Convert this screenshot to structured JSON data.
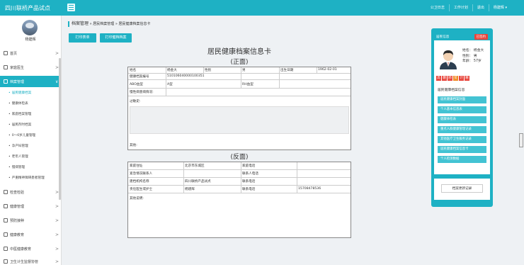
{
  "app": {
    "title": "四川联桥产品试点"
  },
  "topnav": {
    "links": [
      "公卫日志",
      "工作计划",
      "退出",
      "杨建辉 ▾"
    ]
  },
  "sidebar": {
    "user_name": "杨建辉",
    "items": [
      {
        "label": "首页",
        "chevron": ">"
      },
      {
        "label": "家庭医生",
        "chevron": ">"
      },
      {
        "label": "档案管理",
        "chevron": "∨"
      }
    ],
    "sub_items": [
      "居民健康档案",
      "健康体检表",
      "家庭档案管理",
      "居民剂时档案",
      "0～6岁儿童管理",
      "孕产妇管理",
      "老年人管理",
      "慢病管理",
      "严重精神障碍患者管理"
    ],
    "items_after": [
      {
        "label": "检查检验",
        "chevron": ">"
      },
      {
        "label": "健康管理",
        "chevron": ">"
      },
      {
        "label": "预防接种",
        "chevron": ">"
      },
      {
        "label": "健康教育",
        "chevron": ">"
      },
      {
        "label": "中医健康教育",
        "chevron": ">"
      },
      {
        "label": "卫生计生监督协管",
        "chevron": ">"
      }
    ]
  },
  "breadcrumb": {
    "root": "档案管理",
    "sep": "»",
    "p1": "居民档案管理",
    "p2": "居民健康档案信息卡"
  },
  "actions": {
    "print_list": "打印表单",
    "print_card": "打印健档档案"
  },
  "card": {
    "title": "居民健康档案信息卡",
    "front_label": "(正面)",
    "back_label": "(反面)",
    "front": {
      "name_label": "姓名",
      "name": "杨金大",
      "gender_label": "性别",
      "gender": "男",
      "dob_label": "出生日期",
      "dob": "1962-02-01",
      "record_no_label": "健康档案编号",
      "record_no": "510106040000100351",
      "abo_label": "ABO血型",
      "abo": "A型",
      "rh_label": "RH血型",
      "rh": "",
      "chronic_label": "慢性病患病情况:",
      "history_label": "过敏史:",
      "other_label": "其他:"
    },
    "back": {
      "address_label": "家庭住址",
      "address": "北京市东城区",
      "home_phone_label": "家庭电话",
      "home_phone": "",
      "emergency_label": "紧急情况联系人",
      "emergency": "",
      "contact_phone_label": "联系人电话",
      "contact_phone": "",
      "institution_label": "建档机构名称",
      "institution": "四川联桥产品试点",
      "inst_phone_label": "联系电话",
      "inst_phone": "",
      "doctor_label": "责任医生或护士",
      "doctor": "杨建辉",
      "doctor_phone_label": "联系电话",
      "doctor_phone": "15708478536",
      "notes_label": "其他说明:"
    }
  },
  "panel": {
    "header": "居民信息",
    "tag": "已签约",
    "name_line": "姓名： 杨金大",
    "gender_line": "性别： 男",
    "age_line": "年龄： 57岁",
    "tags": [
      {
        "t": "高",
        "c": "#e8453c"
      },
      {
        "t": "糖",
        "c": "#e8453c"
      },
      {
        "t": "肺",
        "c": "#e8453c"
      },
      {
        "t": "贫",
        "c": "#f08a24"
      },
      {
        "t": "计",
        "c": "#e8453c"
      },
      {
        "t": "精",
        "c": "#e8453c"
      }
    ],
    "mid_title": "居民健康档案信息",
    "items": [
      "居民健康档案封面",
      "个人基本信息表",
      "健康体检表",
      "重点人群健康管理记录",
      "其他医疗卫生服务记录",
      "居民健康档案信息卡",
      "个人检测数据"
    ],
    "record_button": "档案更新记录"
  }
}
